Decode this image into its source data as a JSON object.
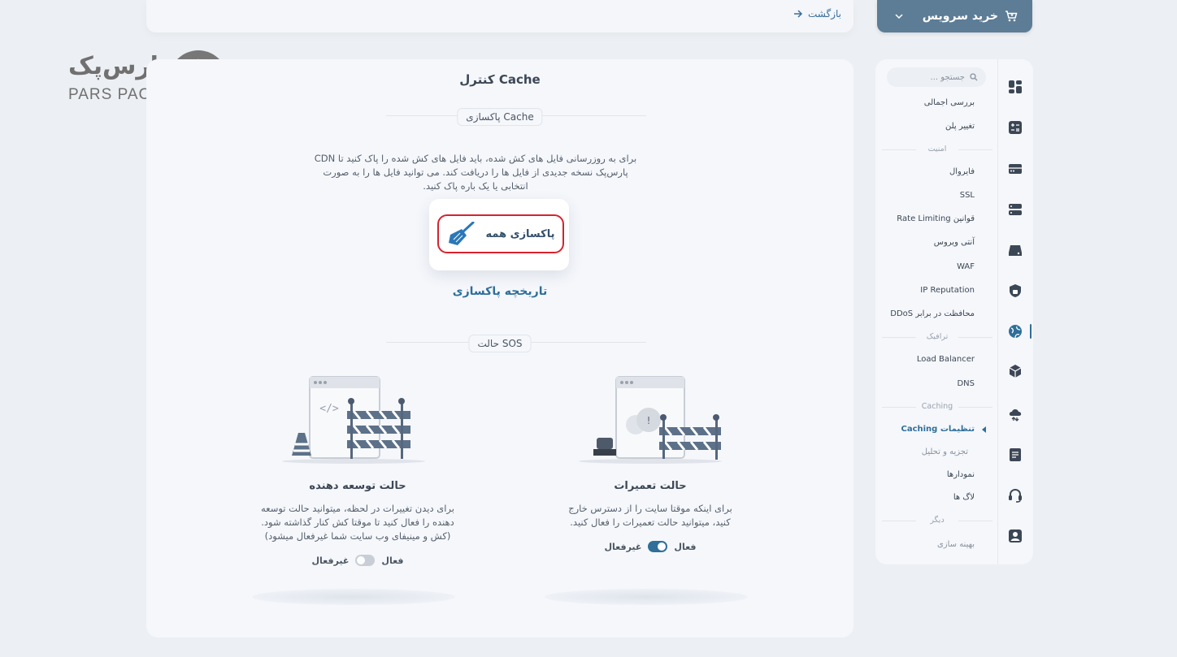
{
  "topbar": {
    "back_label": "بازگشت",
    "buy_label": "خرید سرویس"
  },
  "logo": {
    "fa_text": "پارس‌پک",
    "en_text": "PARS PACK"
  },
  "main": {
    "title": "کنترل Cache",
    "purge_section": {
      "tag": "پاکسازی Cache",
      "description": "برای به روزرسانی فایل های کش شده، باید فایل های کش شده را پاک کنید تا CDN پارس‌پک نسخه جدیدی از فایل ها را دریافت کند. می توانید فایل ها را به صورت انتخابی یا یک باره پاک کنید.",
      "purge_all_label": "پاکسازی همه",
      "history_label": "تاریخچه پاکسازی"
    },
    "sos_section": {
      "tag": "حالت SOS",
      "maintenance": {
        "title": "حالت تعمیرات",
        "description": "برای اینکه موقتا سایت را از دسترس خارج کنید، میتوانید حالت تعمیرات را فعال کنید.",
        "on_label": "فعال",
        "off_label": "غیرفعال",
        "enabled": true
      },
      "developer": {
        "title": "حالت توسعه دهنده",
        "description": "برای دیدن تغییرات در لحظه، میتوانید حالت توسعه دهنده را فعال کنید تا موقتا کش کنار گذاشته شود. (کش و مینیفای وب سایت شما غیرفعال میشود)",
        "on_label": "فعال",
        "off_label": "غیرفعال",
        "enabled": false
      }
    }
  },
  "sidebar": {
    "search_placeholder": "جستجو ...",
    "items": {
      "overview": "بررسی اجمالی",
      "change_plan": "تغییر پلن",
      "security_heading": "امنیت",
      "firewall": "فایروال",
      "ssl": "SSL",
      "rate_limiting": "قوانین Rate Limiting",
      "antivirus": "آنتی ویروس",
      "waf": "WAF",
      "ip_reputation": "IP Reputation",
      "ddos": "محافظت در برابر DDoS",
      "traffic_heading": "ترافیک",
      "load_balancer": "Load Balancer",
      "dns": "DNS",
      "caching_heading": "Caching",
      "caching_settings": "تنظیمات Caching",
      "analysis": "تجزیه و تحلیل",
      "charts": "نمودارها",
      "logs": "لاگ ها",
      "other_heading": "دیگر",
      "optimization": "بهینه سازی"
    }
  },
  "colors": {
    "accent": "#2f6f99",
    "buy_button": "#5d7c96",
    "highlight_border": "#d7232e"
  }
}
